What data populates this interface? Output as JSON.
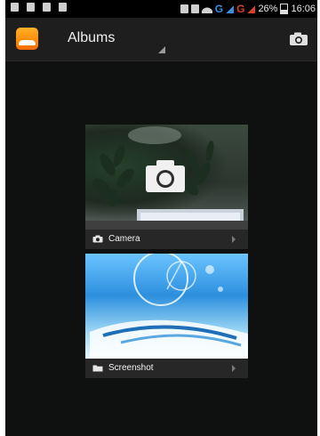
{
  "status_bar": {
    "network_1": "G",
    "network_2": "G",
    "battery": "26%",
    "time": "16:06"
  },
  "action_bar": {
    "title": "Albums",
    "app_icon": "gallery-app-icon",
    "right_icon": "camera-icon"
  },
  "albums": [
    {
      "label": "Camera",
      "icon": "camera-icon"
    },
    {
      "label": "Screenshot",
      "icon": "folder-icon"
    }
  ],
  "colors": {
    "background": "#0f1010",
    "action_bar": "#1e1e1e",
    "app_icon": "#ff8a00",
    "network_blue": "#3f8de0",
    "network_red": "#d8402c"
  }
}
